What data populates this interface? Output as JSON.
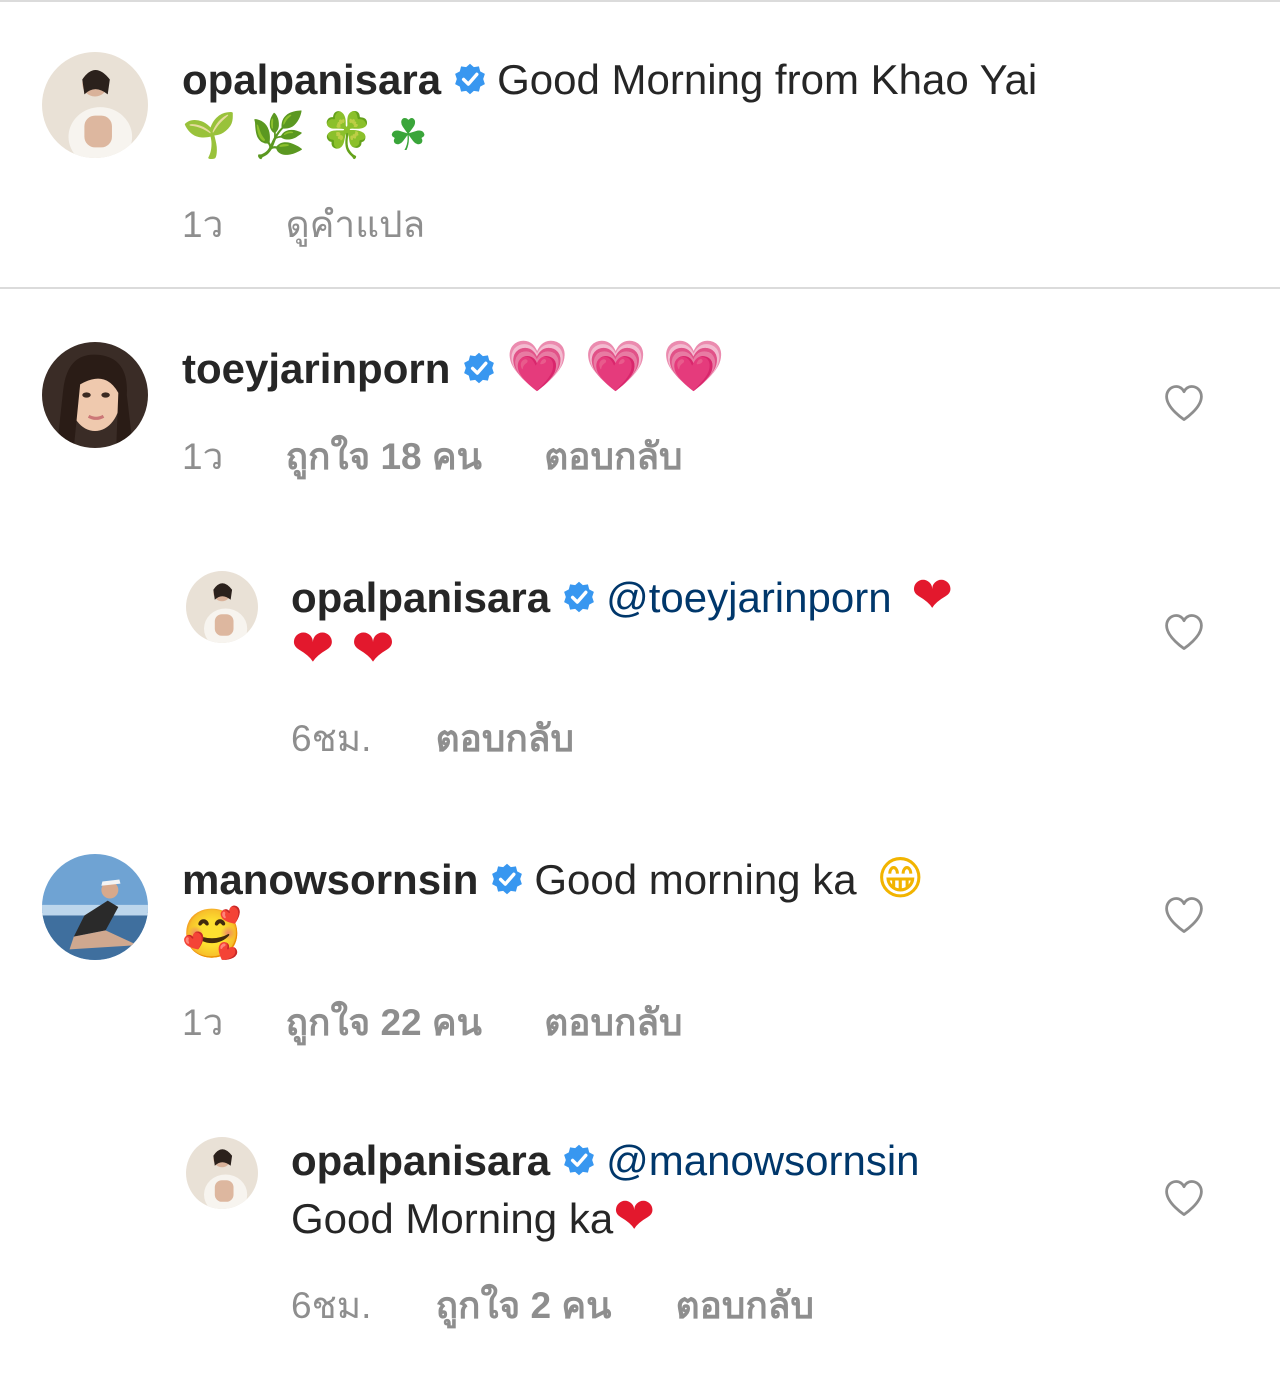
{
  "caption": {
    "username": "opalpanisara",
    "text": "Good Morning from Khao Yai",
    "emojis": "🌱 🌿 🍀 ☘",
    "time": "1ว",
    "translate": "ดูคำแปล"
  },
  "comments": [
    {
      "username": "toeyjarinporn",
      "emojis": "💗 💗 💗",
      "time": "1ว",
      "likes": "ถูกใจ 18 คน",
      "reply": "ตอบกลับ"
    },
    {
      "username": "opalpanisara",
      "mention": "@toeyjarinporn",
      "emoji_line1": "❤",
      "emoji_line2": "❤ ❤",
      "time": "6ชม.",
      "reply": "ตอบกลับ"
    },
    {
      "username": "manowsornsin",
      "text": "Good morning ka",
      "emoji_inline": "😁",
      "emoji_line2": "🥰",
      "time": "1ว",
      "likes": "ถูกใจ 22 คน",
      "reply": "ตอบกลับ"
    },
    {
      "username": "opalpanisara",
      "mention": "@manowsornsin",
      "text": "Good Morning ka",
      "emoji": "❤",
      "time": "6ชม.",
      "likes": "ถูกใจ 2 คน",
      "reply": "ตอบกลับ"
    }
  ],
  "icons": {
    "verified": "verified-badge-icon",
    "like": "heart-outline-icon"
  },
  "colors": {
    "text": "#262626",
    "meta": "#8e8e8e",
    "verified": "#3897f0",
    "mention": "#00376b",
    "divider": "#dbdbdb"
  }
}
